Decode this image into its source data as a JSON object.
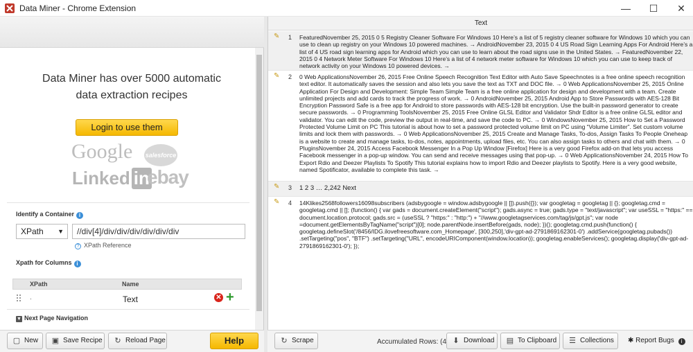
{
  "window": {
    "title": "Data Miner - Chrome Extension",
    "min_symbol": "—",
    "max_symbol": "☐",
    "close_symbol": "✕"
  },
  "left": {
    "promo_line1": "Data Miner has over 5000 automatic",
    "promo_line2": "data extraction recipes",
    "login_label": "Login to use them",
    "logos": {
      "google": "Google",
      "salesforce": "salesforce",
      "linkedin": "Linked",
      "linkedin_in": "in",
      "ebay": "ebay"
    },
    "identify_label": "Identify a Container",
    "container_type": "XPath",
    "container_xpath": "//div[4]/div/div/div/div/div/div",
    "xpath_reference": "XPath Reference",
    "columns_label": "Xpath for Columns",
    "columns_table": {
      "headers": [
        "XPath",
        "Name"
      ],
      "rows": [
        {
          "xpath": ".",
          "name": "Text"
        }
      ]
    },
    "next_page_label": "Next Page Navigation"
  },
  "left_buttons": {
    "new": "New",
    "save": "Save Recipe",
    "reload": "Reload Page",
    "help": "Help"
  },
  "right": {
    "column_header": "Text",
    "rows": [
      {
        "num": "1",
        "text": "FeaturedNovember 25, 2015 0 5 Registry Cleaner Software For Windows 10 Here’s a list of 5 registry cleaner software for Windows 10 which you can use to clean up registry on your Windows 10 powered machines. → AndroidNovember 23, 2015 0 4 US Road Sign Learning Apps For Android Here’s a list of 4 US road sign learning apps for Android which you can use to learn about the road signs use in the United States. → FeaturedNovember 22, 2015 0 4 Network Meter Software For Windows 10 Here’s a list of 4 network meter software for Windows 10 which you can use to keep track of network activity on your Windows 10 powered devices. →"
      },
      {
        "num": "2",
        "text": "0 Web ApplicationsNovember 26, 2015 Free Online Speech Recognition Text Editor with Auto Save Speechnotes is a free online speech recognition text editor. It automatically saves the session and also lets you save the text as TXT and DOC file. → 0 Web ApplicationsNovember 25, 2015 Online Application For Design and Development: Simple Team Simple Team is a free online application for design and development with a team. Create unlimited projects and add cards to track the progress of work. → 0 AndroidNovember 25, 2015 Android App to Store Passwords with AES-128 Bit Encryption Password Safe is a free app for Android to store passwords with AES-128 bit encryption. Use the built-in password generator to create secure passwords. → 0 Programming ToolsNovember 25, 2015 Free Online GLSL Editor and Validator Shdr Editor is a free online GLSL editor and validator. You can edit the code, preview the output in real-time, and save the code to PC. → 0 WindowsNovember 25, 2015 How to Set a Password Protected Volume Limit on PC This tutorial is about how to set a password protected volume limit on PC using “Volume Limiter”. Set custom volume limits and lock them with passwords. → 0 Web ApplicationsNovember 25, 2015 Create and Manage Tasks, To-dos, Assign Tasks To People Oneheap is a website to create and manage tasks, to-dos, notes, appointments, upload files, etc. You can also assign tasks to others and chat with them. → 0 PluginsNovember 24, 2015 Access Facebook Messenger In a Pop Up Window [Firefox] Here is a very good Firefox add-on that lets you access Facebook messenger in a pop-up window. You can send and receive messages using that pop-up. → 0 Web ApplicationsNovember 24, 2015 How To Export Rdio and Deezer Playlists To Spotify This tutorial explains how to import Rdio and Deezer playlists to Spotify. Here is a very good website, named Spotificator, available to complete this task. →"
      },
      {
        "num": "3",
        "text": "1 2 3 … 2,242 Next"
      },
      {
        "num": "4",
        "text": "14Klikes2568followers16098subscribers (adsbygoogle = window.adsbygoogle || []).push({}); var googletag = googletag || {}; googletag.cmd = googletag.cmd || []; (function() { var gads = document.createElement(\"script\"); gads.async = true; gads.type = \"text/javascript\"; var useSSL = \"https:\" == document.location.protocol; gads.src = (useSSL ? \"https:\" : \"http:\") + \"//www.googletagservices.com/tag/js/gpt.js\"; var node =document.getElementsByTagName(\"script\")[0]; node.parentNode.insertBefore(gads, node); })(); googletag.cmd.push(function() { googletag.defineSlot('/8456/IDG.ilovefreesoftware.com_Homepage', [300,250],'div-gpt-ad-2791869162301-0') .addService(googletag.pubads()) .setTargeting(\"pos\", \"BTF\") .setTargeting(\"URL\", encodeURIComponent(window.location)); googletag.enableServices(); googletag.display('div-gpt-ad-2791869162301-0'); });"
      }
    ]
  },
  "right_buttons": {
    "scrape": "Scrape",
    "accumulated": "Accumulated Rows: (4)",
    "download": "Download",
    "clipboard": "To Clipboard",
    "collections": "Collections",
    "report": "Report Bugs"
  },
  "icons": {
    "info": "i",
    "pencil": "✎"
  }
}
